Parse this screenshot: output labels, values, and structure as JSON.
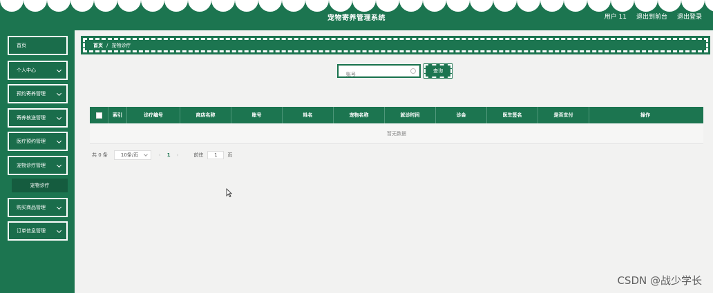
{
  "header": {
    "title": "宠物寄养管理系统",
    "links": [
      "用户 11",
      "退出到前台",
      "退出登录"
    ]
  },
  "sidebar": {
    "items": [
      {
        "label": "首页"
      },
      {
        "label": "个人中心"
      },
      {
        "label": "预约寄养管理"
      },
      {
        "label": "寄养核送管理"
      },
      {
        "label": "医疗预约管理"
      },
      {
        "label": "宠物诊疗管理"
      },
      {
        "label": "宠物诊疗"
      },
      {
        "label": "购买商品管理"
      },
      {
        "label": "订单信息管理"
      }
    ]
  },
  "breadcrumb": {
    "home": "首页",
    "separator": "/",
    "current": "宠物诊疗"
  },
  "search": {
    "placeholder": "账号",
    "button": "查询"
  },
  "table": {
    "columns": [
      "索引",
      "诊疗编号",
      "商店名称",
      "账号",
      "姓名",
      "宠物名称",
      "就诊时间",
      "诊金",
      "医生签名",
      "是否支付",
      "操作"
    ],
    "empty_text": "暂无数据"
  },
  "pagination": {
    "total": "共 0 条",
    "page_size": "10条/页",
    "prev": "‹",
    "current": "1",
    "next": "›",
    "jump_prefix": "前往",
    "jump_value": "1",
    "jump_suffix": "页"
  },
  "watermark": "CSDN @战少学长",
  "colors": {
    "primary": "#1c7550",
    "background": "#f2f2f1"
  }
}
